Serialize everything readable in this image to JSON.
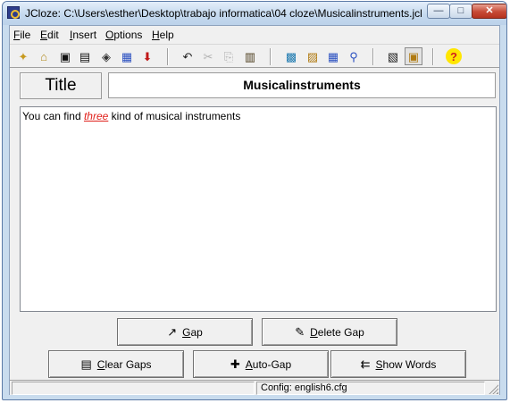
{
  "window": {
    "title": "JCloze: C:\\Users\\esther\\Desktop\\trabajo informatica\\04 cloze\\Musicalinstruments.jcl",
    "minimize_glyph": "—",
    "maximize_glyph": "□",
    "close_glyph": "✕"
  },
  "menu": [
    {
      "label": "File",
      "u": "F",
      "rest": "ile"
    },
    {
      "label": "Edit",
      "u": "E",
      "rest": "dit"
    },
    {
      "label": "Insert",
      "u": "I",
      "rest": "nsert"
    },
    {
      "label": "Options",
      "u": "O",
      "rest": "ptions"
    },
    {
      "label": "Help",
      "u": "H",
      "rest": "elp"
    }
  ],
  "toolbar": {
    "icons": [
      "new-file-icon",
      "open-folder-icon",
      "save-icon",
      "save-as-icon",
      "clear-icon",
      "gap-manager-icon",
      "insert-arrow-icon",
      "undo-icon",
      "cut-icon",
      "copy-icon",
      "paste-icon",
      "create-web-page-icon",
      "export-icon",
      "grid-icon",
      "find-icon",
      "view-icon",
      "screen-icon",
      "help-icon"
    ],
    "glyphs": {
      "new": "✦",
      "open": "⌂",
      "save": "▣",
      "save_as": "▤",
      "clear": "◈",
      "gap_manager": "▦",
      "insert_arrow": "⬇",
      "undo": "↶",
      "cut": "✂",
      "copy": "⎘",
      "paste": "▥",
      "web_page": "▩",
      "export": "▨",
      "grid": "▦",
      "find": "⚲",
      "view": "▧",
      "screen": "▣",
      "help": "?"
    }
  },
  "title_field": {
    "label": "Title",
    "value": "Musicalinstruments"
  },
  "editor": {
    "before": "You can find ",
    "gap_word": "three",
    "after": " kind of musical instruments"
  },
  "buttons": {
    "gap": {
      "icon": "↗",
      "u": "G",
      "rest": "ap"
    },
    "delete_gap": {
      "icon": "✎",
      "u": "D",
      "rest": "elete Gap"
    },
    "clear_gaps": {
      "icon": "▤",
      "u": "C",
      "rest": "lear Gaps"
    },
    "auto_gap": {
      "icon": "✚",
      "u": "A",
      "rest": "uto-Gap"
    },
    "show_words": {
      "icon": "⇇",
      "u": "S",
      "rest": "how Words"
    }
  },
  "status": {
    "config": "Config: english6.cfg"
  },
  "colors": {
    "gap_word": "#e0201b",
    "title_bar": "#c5d9ee",
    "close_button": "#c74a36"
  }
}
